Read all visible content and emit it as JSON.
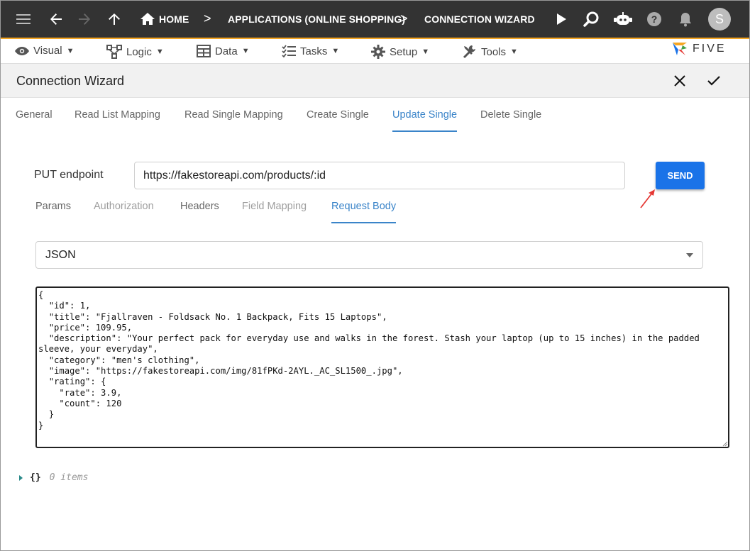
{
  "topbar": {
    "breadcrumbs": [
      "HOME",
      "APPLICATIONS (ONLINE SHOPPING)",
      "CONNECTION WIZARD"
    ],
    "separator": ">",
    "avatar_initial": "S",
    "icons": [
      "menu-icon",
      "back-arrow-icon",
      "forward-arrow-icon",
      "up-arrow-icon",
      "home-icon",
      "play-icon",
      "search-icon",
      "chat-bot-icon",
      "help-icon",
      "bell-icon"
    ]
  },
  "menubar": {
    "items": [
      {
        "label": "Visual",
        "icon": "eye-icon"
      },
      {
        "label": "Logic",
        "icon": "logic-icon"
      },
      {
        "label": "Data",
        "icon": "table-icon"
      },
      {
        "label": "Tasks",
        "icon": "tasks-icon"
      },
      {
        "label": "Setup",
        "icon": "gear-icon"
      },
      {
        "label": "Tools",
        "icon": "tools-icon"
      }
    ],
    "caret": "▼",
    "logo_text": "FIVE"
  },
  "titlebar": {
    "title": "Connection Wizard"
  },
  "tabs": [
    "General",
    "Read List Mapping",
    "Read Single Mapping",
    "Create Single",
    "Update Single",
    "Delete Single"
  ],
  "active_tab": "Update Single",
  "endpoint": {
    "label": "PUT endpoint",
    "value": "https://fakestoreapi.com/products/:id",
    "send_label": "SEND"
  },
  "subtabs": [
    {
      "label": "Params",
      "state": "normal"
    },
    {
      "label": "Authorization",
      "state": "disabled"
    },
    {
      "label": "Headers",
      "state": "normal"
    },
    {
      "label": "Field Mapping",
      "state": "disabled"
    },
    {
      "label": "Request Body",
      "state": "active"
    }
  ],
  "body_type": {
    "selected": "JSON"
  },
  "request_body": "{\n  \"id\": 1,\n  \"title\": \"Fjallraven - Foldsack No. 1 Backpack, Fits 15 Laptops\",\n  \"price\": 109.95,\n  \"description\": \"Your perfect pack for everyday use and walks in the forest. Stash your laptop (up to 15 inches) in the padded sleeve, your everyday\",\n  \"category\": \"men's clothing\",\n  \"image\": \"https://fakestoreapi.com/img/81fPKd-2AYL._AC_SL1500_.jpg\",\n  \"rating\": {\n    \"rate\": 3.9,\n    \"count\": 120\n  }\n}",
  "tree": {
    "braces": "{}",
    "count": "0 items"
  },
  "colors": {
    "accent": "#3a84c9",
    "send": "#1a73e8",
    "topbar": "#333333",
    "highlight_arrow": "#e53935"
  }
}
